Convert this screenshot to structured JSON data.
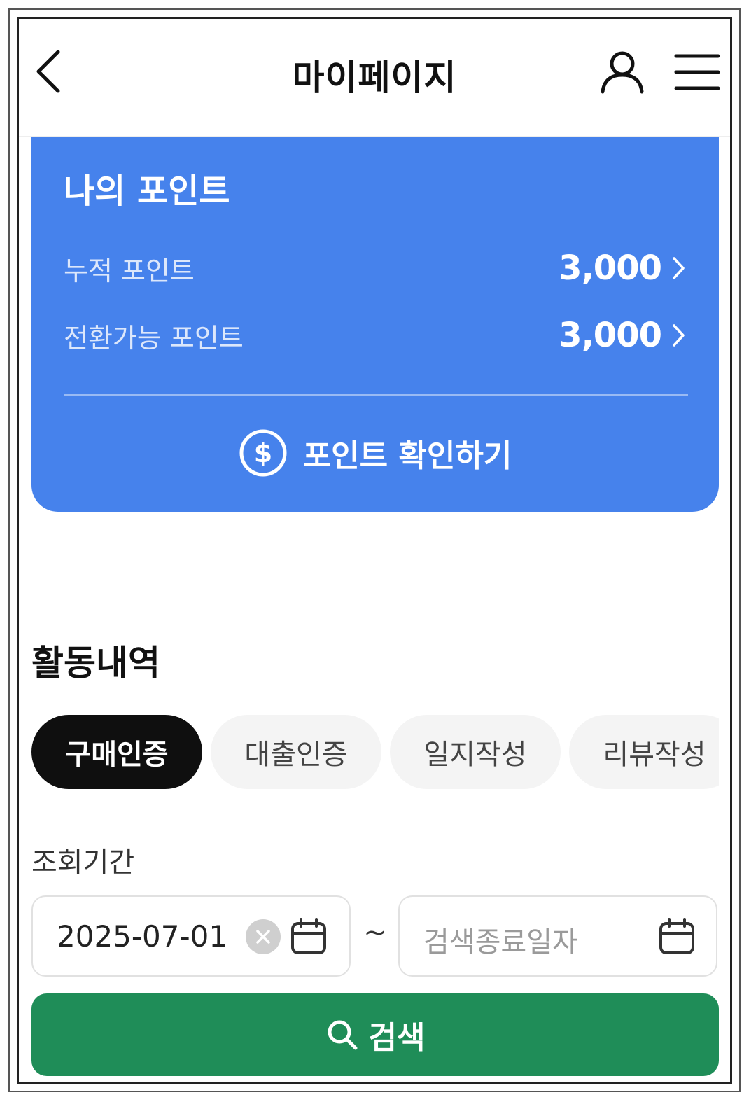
{
  "header": {
    "title": "마이페이지",
    "back_icon": "chevron-left-icon",
    "user_icon": "user-icon",
    "menu_icon": "hamburger-menu-icon"
  },
  "points": {
    "title": "나의 포인트",
    "rows": [
      {
        "label": "누적 포인트",
        "value": "3,000"
      },
      {
        "label": "전환가능 포인트",
        "value": "3,000"
      }
    ],
    "check_label": "포인트 확인하기",
    "check_icon": "dollar-circle-icon",
    "colors": {
      "card_bg": "#4682ec"
    }
  },
  "activity": {
    "title": "활동내역",
    "tabs": [
      {
        "label": "구매인증",
        "active": true
      },
      {
        "label": "대출인증",
        "active": false
      },
      {
        "label": "일지작성",
        "active": false
      },
      {
        "label": "리뷰작성",
        "active": false
      }
    ]
  },
  "period": {
    "label": "조회기간",
    "start_value": "2025-07-01",
    "end_placeholder": "검색종료일자",
    "separator": "~"
  },
  "search": {
    "label": "검색",
    "icon": "search-icon",
    "color": "#1f8d58"
  }
}
